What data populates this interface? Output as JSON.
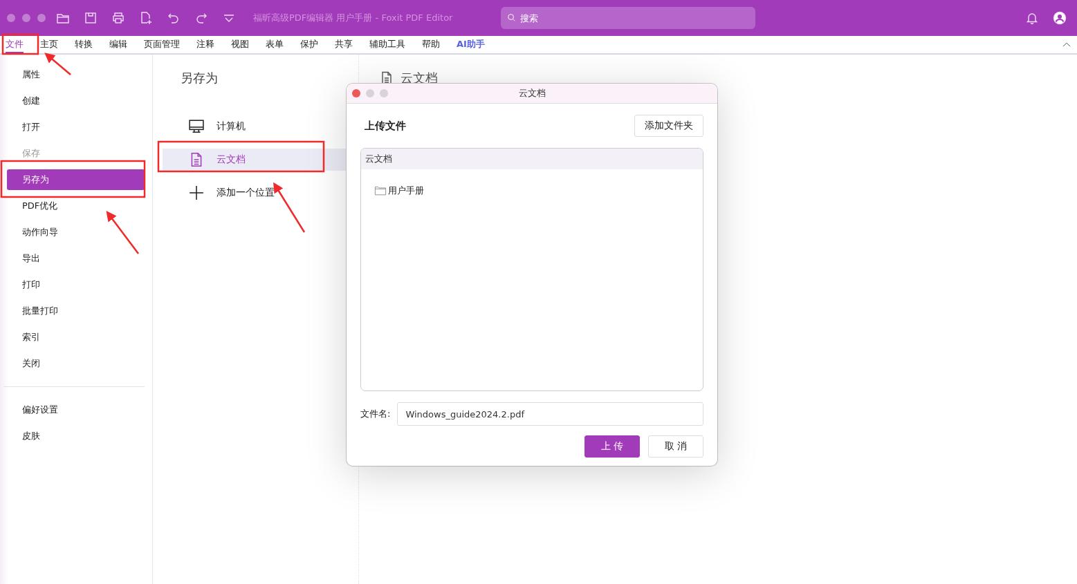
{
  "window": {
    "title": "福昕高级PDF编辑器 用户手册 - Foxit PDF Editor"
  },
  "search": {
    "placeholder": "搜索"
  },
  "ribbon_tabs": [
    {
      "label": "文件",
      "selected": true,
      "kind": "plain"
    },
    {
      "label": "主页",
      "selected": false,
      "kind": "plain"
    },
    {
      "label": "转换",
      "selected": false,
      "kind": "plain"
    },
    {
      "label": "编辑",
      "selected": false,
      "kind": "plain"
    },
    {
      "label": "页面管理",
      "selected": false,
      "kind": "plain"
    },
    {
      "label": "注释",
      "selected": false,
      "kind": "plain"
    },
    {
      "label": "视图",
      "selected": false,
      "kind": "plain"
    },
    {
      "label": "表单",
      "selected": false,
      "kind": "plain"
    },
    {
      "label": "保护",
      "selected": false,
      "kind": "plain"
    },
    {
      "label": "共享",
      "selected": false,
      "kind": "plain"
    },
    {
      "label": "辅助工具",
      "selected": false,
      "kind": "plain"
    },
    {
      "label": "帮助",
      "selected": false,
      "kind": "plain"
    },
    {
      "label": "AI助手",
      "selected": false,
      "kind": "ai"
    }
  ],
  "sidebar": {
    "items": [
      {
        "label": "属性",
        "selected": false,
        "disabled": false
      },
      {
        "label": "创建",
        "selected": false,
        "disabled": false
      },
      {
        "label": "打开",
        "selected": false,
        "disabled": false
      },
      {
        "label": "保存",
        "selected": false,
        "disabled": true
      },
      {
        "label": "另存为",
        "selected": true,
        "disabled": false
      },
      {
        "label": "PDF优化",
        "selected": false,
        "disabled": false
      },
      {
        "label": "动作向导",
        "selected": false,
        "disabled": false
      },
      {
        "label": "导出",
        "selected": false,
        "disabled": false
      },
      {
        "label": "打印",
        "selected": false,
        "disabled": false
      },
      {
        "label": "批量打印",
        "selected": false,
        "disabled": false
      },
      {
        "label": "索引",
        "selected": false,
        "disabled": false
      },
      {
        "label": "关闭",
        "selected": false,
        "disabled": false
      }
    ],
    "bottom_items": [
      {
        "label": "偏好设置",
        "selected": false
      },
      {
        "label": "皮肤",
        "selected": false
      }
    ]
  },
  "save_as": {
    "title": "另存为",
    "locations": [
      {
        "label": "计算机",
        "kind": "computer",
        "selected": false
      },
      {
        "label": "云文档",
        "kind": "cloud",
        "selected": true
      },
      {
        "label": "添加一个位置",
        "kind": "add",
        "selected": false
      }
    ]
  },
  "detail": {
    "title": "云文档"
  },
  "dialog": {
    "title": "云文档",
    "heading": "上传文件",
    "add_folder_button": "添加文件夹",
    "tree": {
      "header": "云文档",
      "folders": [
        "用户手册"
      ]
    },
    "filename_label": "文件名:",
    "filename": "Windows_guide2024.2.pdf",
    "buttons": [
      {
        "label": "上 传",
        "kind": "primary"
      },
      {
        "label": "取 消",
        "kind": "secondary"
      }
    ]
  }
}
